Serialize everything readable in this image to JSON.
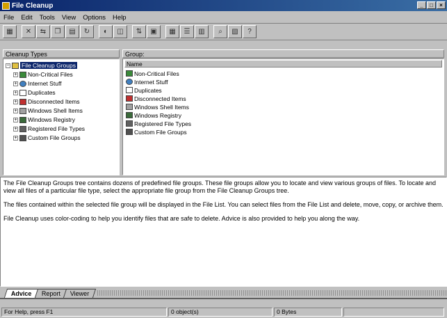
{
  "window": {
    "title": "File Cleanup"
  },
  "menu": [
    "File",
    "Edit",
    "Tools",
    "View",
    "Options",
    "Help"
  ],
  "toolbar": {
    "buttons": [
      "new-icon",
      "delete-icon",
      "move-icon",
      "copy-icon",
      "archive-icon",
      "refresh-icon",
      "preview-icon",
      "filter-icon",
      "sort-icon",
      "large-icons-icon",
      "small-icons-icon",
      "list-icon",
      "details-icon",
      "find-icon",
      "properties-icon",
      "help-icon"
    ]
  },
  "left_pane": {
    "header": "Cleanup Types",
    "items": [
      {
        "label": "File Cleanup Groups",
        "icon": "folder-icon",
        "expand": "−",
        "selected": true
      },
      {
        "label": "Non-Critical Files",
        "icon": "group-icon",
        "expand": "+"
      },
      {
        "label": "Internet Stuff",
        "icon": "globe-icon",
        "expand": "+"
      },
      {
        "label": "Duplicates",
        "icon": "duplicate-icon",
        "expand": "+"
      },
      {
        "label": "Disconnected Items",
        "icon": "disconnect-icon",
        "expand": "+"
      },
      {
        "label": "Windows Shell Items",
        "icon": "shell-icon",
        "expand": "+"
      },
      {
        "label": "Windows Registry",
        "icon": "registry-icon",
        "expand": "+"
      },
      {
        "label": "Registered File Types",
        "icon": "filetype-icon",
        "expand": "+"
      },
      {
        "label": "Custom File Groups",
        "icon": "custom-group-icon",
        "expand": "+"
      }
    ]
  },
  "right_pane": {
    "header": "Group:",
    "column": "Name",
    "items": [
      {
        "label": "Non-Critical Files",
        "icon": "group-icon"
      },
      {
        "label": "Internet Stuff",
        "icon": "globe-icon"
      },
      {
        "label": "Duplicates",
        "icon": "duplicate-icon"
      },
      {
        "label": "Disconnected Items",
        "icon": "disconnect-icon"
      },
      {
        "label": "Windows Shell Items",
        "icon": "shell-icon"
      },
      {
        "label": "Windows Registry",
        "icon": "registry-icon"
      },
      {
        "label": "Registered File Types",
        "icon": "filetype-icon"
      },
      {
        "label": "Custom File Groups",
        "icon": "custom-group-icon"
      }
    ]
  },
  "description": {
    "p1": "The File Cleanup Groups tree contains dozens of predefined file groups. These file groups allow you to locate and view various groups of files. To locate and view all files of a particular file type, select the appropriate file group from the File Cleanup Groups tree.",
    "p2": "The files contained within the selected file group will be displayed in the File List. You can select files from the File List and delete, move, copy, or archive them.",
    "p3": "File Cleanup uses color-coding to help you identify files that are safe to delete. Advice is also provided to help you along the way."
  },
  "tabs": [
    {
      "label": "Advice",
      "active": true
    },
    {
      "label": "Report",
      "active": false
    },
    {
      "label": "Viewer",
      "active": false
    }
  ],
  "status": {
    "help": "For Help, press F1",
    "objects": "0 object(s)",
    "bytes": "0 Bytes"
  },
  "colors": {
    "title_start": "#0a246a",
    "title_end": "#3a6ea5",
    "selection": "#0a246a"
  }
}
